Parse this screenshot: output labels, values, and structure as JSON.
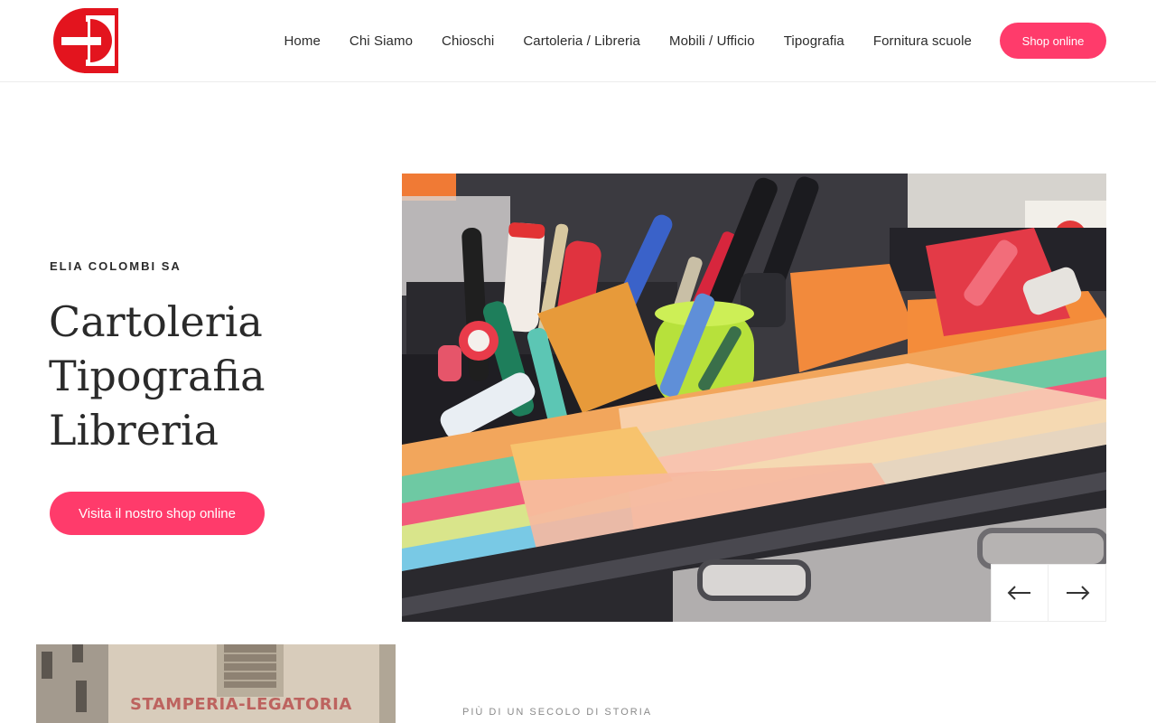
{
  "header": {
    "logo_name": "logo-icon",
    "nav": [
      {
        "label": "Home"
      },
      {
        "label": "Chi Siamo"
      },
      {
        "label": "Chioschi"
      },
      {
        "label": "Cartoleria / Libreria"
      },
      {
        "label": "Mobili / Ufficio"
      },
      {
        "label": "Tipografia"
      },
      {
        "label": "Fornitura scuole"
      }
    ],
    "shop_label": "Shop online"
  },
  "hero": {
    "eyebrow": "ELIA COLOMBI SA",
    "title_lines": [
      "Cartoleria",
      "Tipografia",
      "Libreria"
    ],
    "cta_label": "Visita il nostro shop online",
    "prev_icon": "arrow-left-icon",
    "next_icon": "arrow-right-icon"
  },
  "history": {
    "image_sign_text": "STAMPERIA-LEGATORIA",
    "eyebrow": "PIÙ DI UN SECOLO DI STORIA"
  },
  "colors": {
    "accent": "#ff3b6b",
    "logo_red": "#e3141e",
    "text": "#2a2a2a"
  }
}
